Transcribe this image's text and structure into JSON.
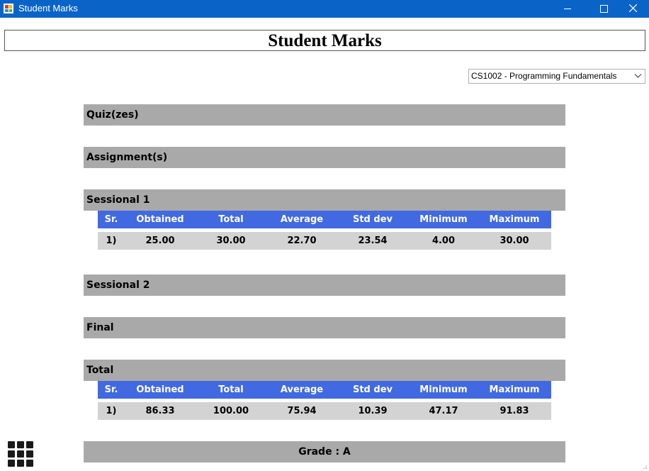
{
  "window": {
    "title": "Student Marks"
  },
  "heading": "Student Marks",
  "course_select": {
    "selected": "CS1002 - Programming Fundamentals"
  },
  "sections": {
    "quizzes": "Quiz(zes)",
    "assignments": "Assignment(s)",
    "sessional1": "Sessional 1",
    "sessional2": "Sessional 2",
    "final": "Final",
    "total": "Total"
  },
  "table_columns": [
    "Sr.",
    "Obtained",
    "Total",
    "Average",
    "Std dev",
    "Minimum",
    "Maximum"
  ],
  "sessional1_rows": [
    [
      "1)",
      "25.00",
      "30.00",
      "22.70",
      "23.54",
      "4.00",
      "30.00"
    ]
  ],
  "total_rows": [
    [
      "1)",
      "86.33",
      "100.00",
      "75.94",
      "10.39",
      "47.17",
      "91.83"
    ]
  ],
  "grade_text": "Grade : A",
  "colors": {
    "titlebar": "#0a64c8",
    "section_bar": "#a9a9a9",
    "table_header": "#4169e1",
    "table_row": "#d3d3d3"
  },
  "icons": {
    "app": "app-icon",
    "minimize": "minimize-icon",
    "maximize": "maximize-icon",
    "close": "close-icon",
    "dropdown": "chevron-down-icon",
    "launcher": "grid-menu-icon"
  }
}
